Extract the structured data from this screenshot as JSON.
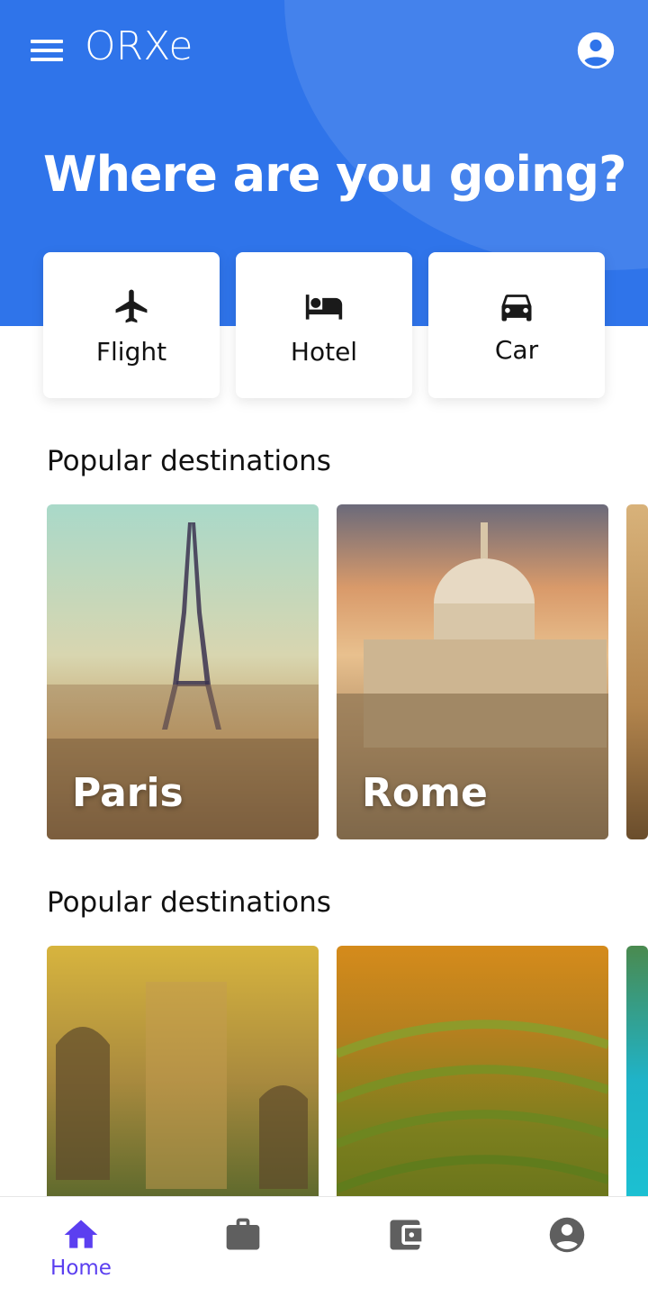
{
  "app": {
    "title": "ORXe"
  },
  "header": {
    "headline": "Where are you going?"
  },
  "categories": [
    {
      "label": "Flight",
      "icon": "airplane-icon"
    },
    {
      "label": "Hotel",
      "icon": "bed-icon"
    },
    {
      "label": "Car",
      "icon": "car-icon"
    }
  ],
  "sections": [
    {
      "title": "Popular destinations",
      "destinations": [
        {
          "name": "Paris"
        },
        {
          "name": "Rome"
        },
        {
          "name": ""
        }
      ]
    },
    {
      "title": "Popular destinations",
      "destinations": [
        {
          "name": ""
        },
        {
          "name": ""
        },
        {
          "name": ""
        }
      ]
    }
  ],
  "bottom_nav": {
    "items": [
      {
        "label": "Home",
        "icon": "home-icon",
        "active": true
      },
      {
        "label": "",
        "icon": "briefcase-icon"
      },
      {
        "label": "",
        "icon": "wallet-icon"
      },
      {
        "label": "",
        "icon": "account-circle-icon"
      }
    ]
  },
  "colors": {
    "primary": "#2f74ea",
    "nav_active": "#5b3ff0",
    "icon_inactive": "#5f5f5f"
  }
}
